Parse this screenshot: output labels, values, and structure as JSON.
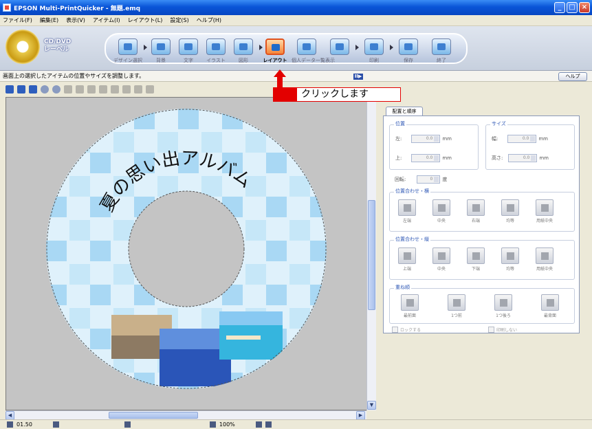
{
  "window": {
    "title": "EPSON Multi-PrintQuicker - 無題.emq",
    "controls": [
      "_",
      "□",
      "×"
    ]
  },
  "menu": [
    "ファイル(F)",
    "編集(E)",
    "表示(V)",
    "アイテム(I)",
    "レイアウト(L)",
    "設定(S)",
    "ヘルプ(H)"
  ],
  "toolbar": {
    "logo_text_1": "CD/DVD",
    "logo_text_2": "レーベル",
    "buttons": [
      {
        "label": "デザイン選択",
        "active": false
      },
      {
        "label": "背景",
        "active": false
      },
      {
        "label": "文字",
        "active": false
      },
      {
        "label": "イラスト",
        "active": false
      },
      {
        "label": "図形",
        "active": false
      },
      {
        "label": "レイアウト",
        "active": true
      },
      {
        "label": "個人データ一覧表示",
        "active": false
      },
      {
        "label": "",
        "active": false
      },
      {
        "label": "印刷",
        "active": false
      },
      {
        "label": "保存",
        "active": false
      },
      {
        "label": "終了",
        "active": false
      }
    ]
  },
  "hint": {
    "text": "画面上の選択したアイテムの位置やサイズを調整します。",
    "collapse_label": "II▶",
    "help_label": "ヘルプ"
  },
  "callout": {
    "text": "クリックします"
  },
  "canvas": {
    "disc_title": "夏の思い出アルバム"
  },
  "panel": {
    "tab_label": "配置と順序",
    "position": {
      "title": "位置",
      "left_label": "左:",
      "left_value": "0.0",
      "top_label": "上:",
      "top_value": "0.0",
      "unit": "mm"
    },
    "size": {
      "title": "サイズ",
      "width_label": "幅:",
      "width_value": "0.0",
      "height_label": "高さ:",
      "height_value": "0.0",
      "unit": "mm"
    },
    "rotation": {
      "label": "回転:",
      "value": "0",
      "unit": "度"
    },
    "align_h": {
      "title": "位置合わせ・横",
      "buttons": [
        "左端",
        "中央",
        "右端",
        "均等",
        "用紙中央"
      ]
    },
    "align_v": {
      "title": "位置合わせ・縦",
      "buttons": [
        "上端",
        "中央",
        "下端",
        "均等",
        "用紙中央"
      ]
    },
    "order": {
      "title": "重ね順",
      "buttons": [
        "最前面",
        "1つ前",
        "1つ後ろ",
        "最背面"
      ]
    },
    "lock_label": "ロックする",
    "noprint_label": "印刷しない"
  },
  "status": {
    "coords": "01.50",
    "zoom": "100%"
  },
  "colors": {
    "accent_red": "#e30000",
    "title_blue": "#0a55d8",
    "disc_light": "#dff1fb",
    "disc_tile": "#a9d8f4"
  }
}
